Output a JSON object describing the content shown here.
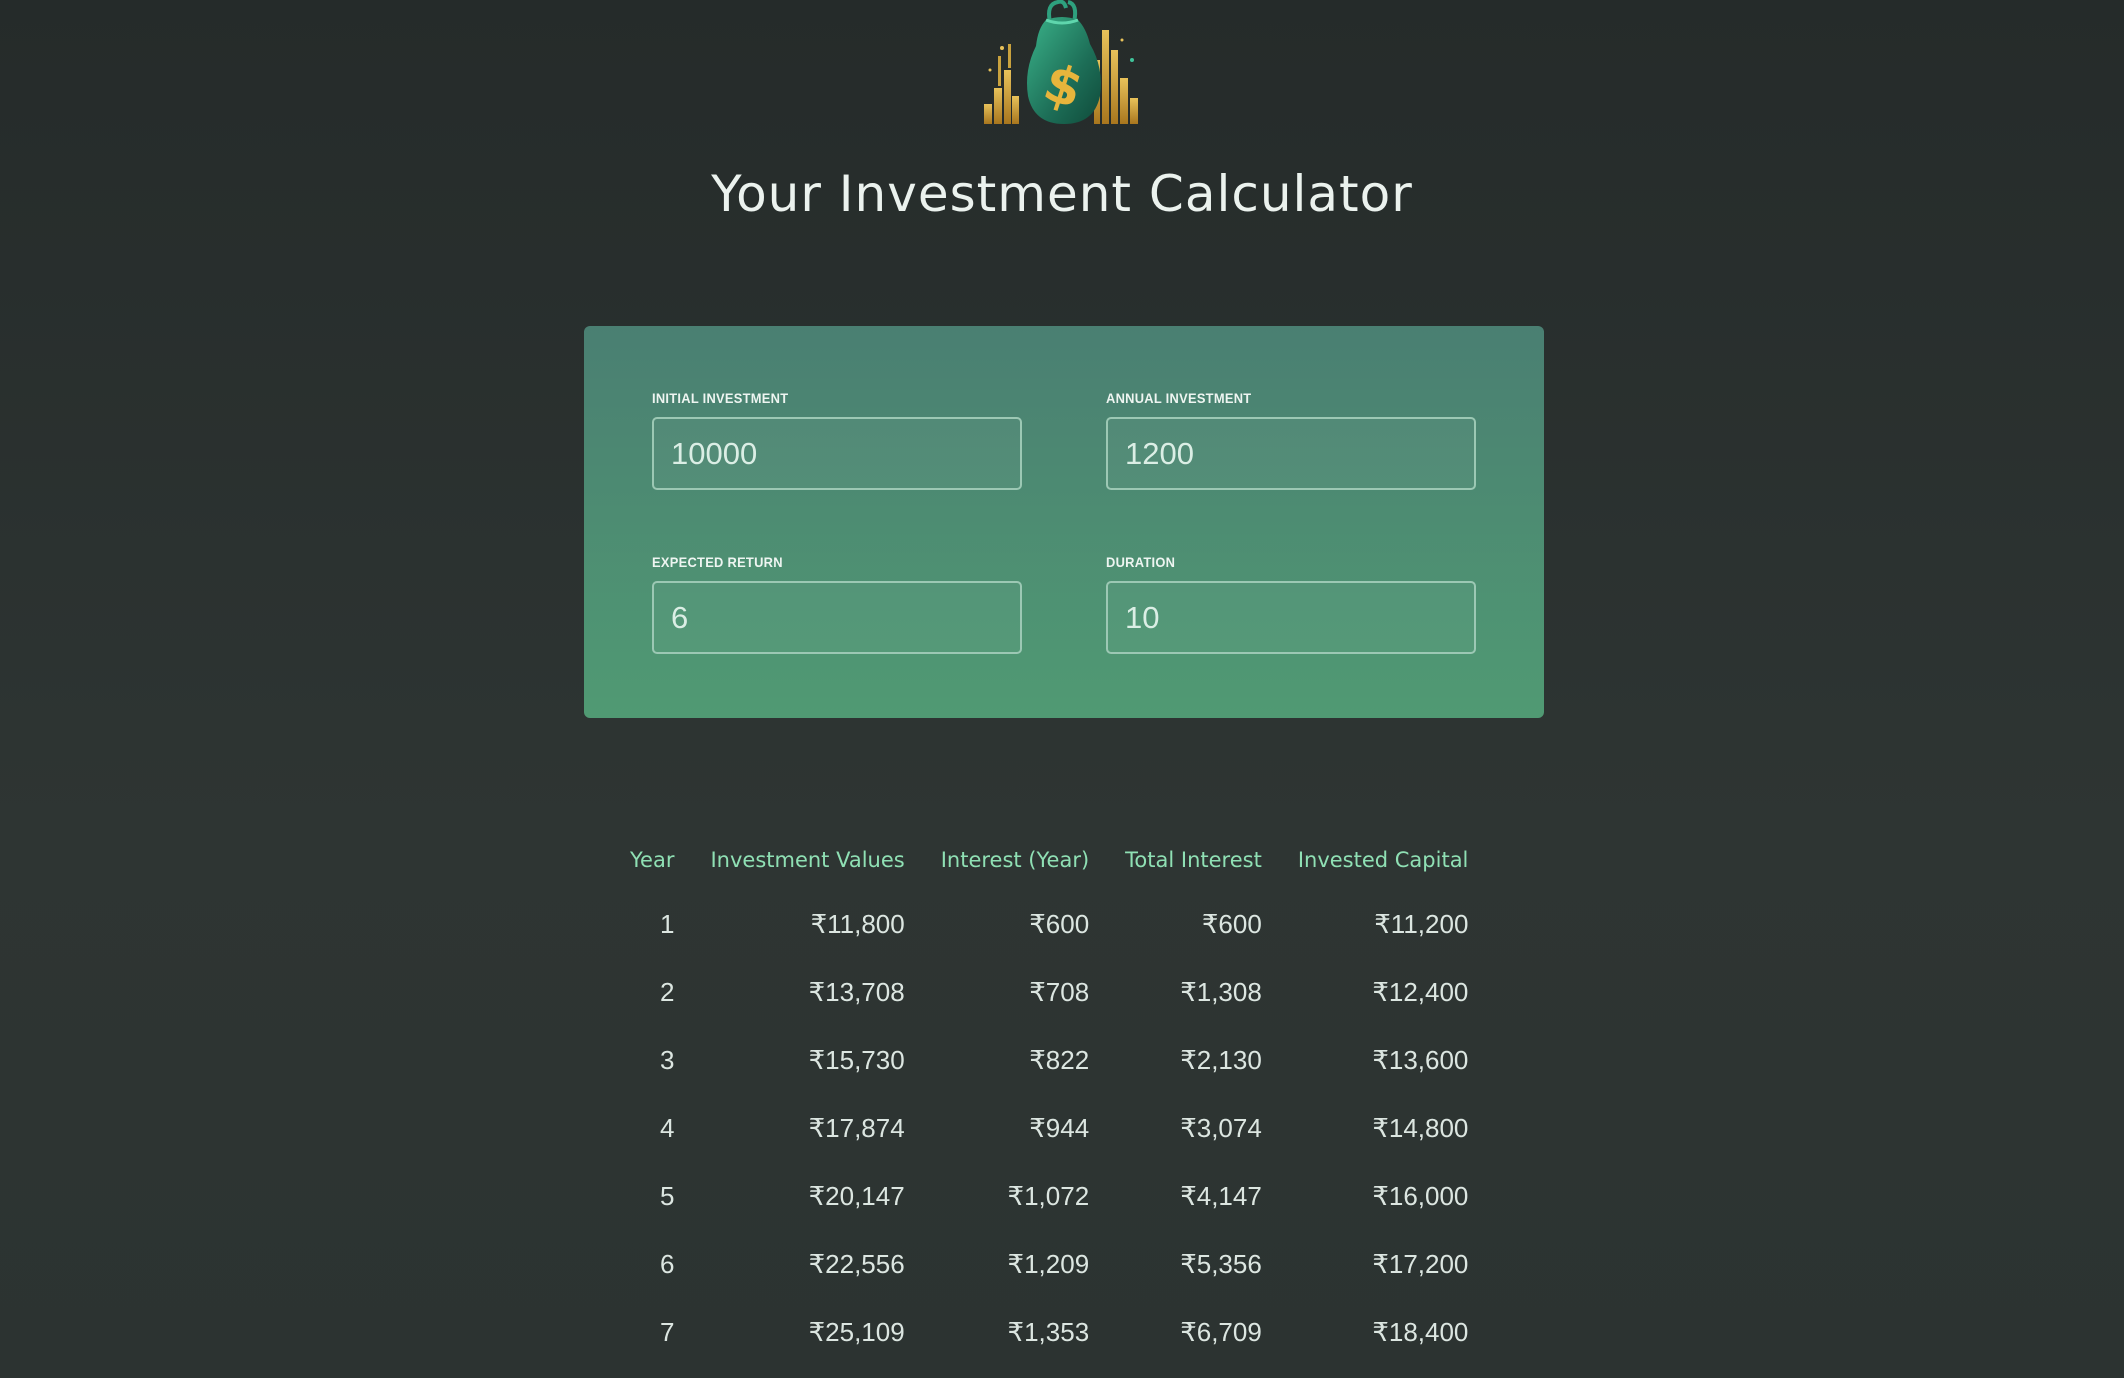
{
  "header": {
    "logo_icon": "money-bag-icon",
    "title": "Your Investment Calculator"
  },
  "colors": {
    "background": "#2a302f",
    "panel_top": "#4a7f72",
    "panel_bottom": "#509a73",
    "table_header": "#8fe0b4",
    "text": "#ebf2ee"
  },
  "inputs": {
    "initial_investment": {
      "label": "INITIAL INVESTMENT",
      "value": "10000"
    },
    "annual_investment": {
      "label": "ANNUAL INVESTMENT",
      "value": "1200"
    },
    "expected_return": {
      "label": "EXPECTED RETURN",
      "value": "6"
    },
    "duration": {
      "label": "DURATION",
      "value": "10"
    }
  },
  "table": {
    "headers": [
      "Year",
      "Investment Values",
      "Interest (Year)",
      "Total Interest",
      "Invested Capital"
    ],
    "rows": [
      [
        "1",
        "₹11,800",
        "₹600",
        "₹600",
        "₹11,200"
      ],
      [
        "2",
        "₹13,708",
        "₹708",
        "₹1,308",
        "₹12,400"
      ],
      [
        "3",
        "₹15,730",
        "₹822",
        "₹2,130",
        "₹13,600"
      ],
      [
        "4",
        "₹17,874",
        "₹944",
        "₹3,074",
        "₹14,800"
      ],
      [
        "5",
        "₹20,147",
        "₹1,072",
        "₹4,147",
        "₹16,000"
      ],
      [
        "6",
        "₹22,556",
        "₹1,209",
        "₹5,356",
        "₹17,200"
      ],
      [
        "7",
        "₹25,109",
        "₹1,353",
        "₹6,709",
        "₹18,400"
      ]
    ]
  }
}
